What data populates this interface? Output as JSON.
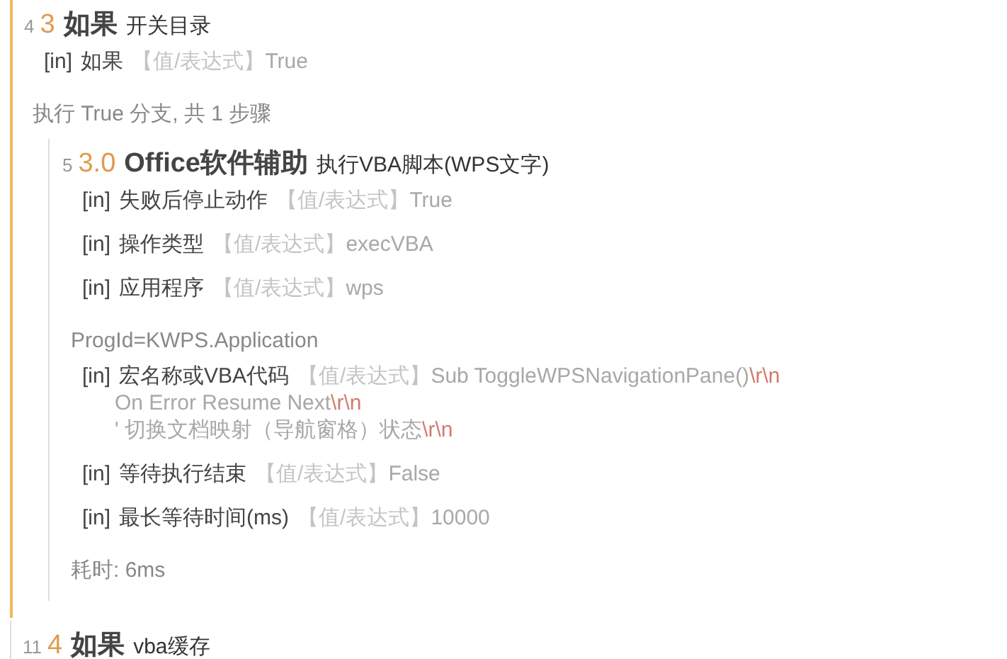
{
  "blocks": [
    {
      "line_no": "4",
      "index": "3",
      "title": "如果",
      "description": "开关目录",
      "highlighted": true,
      "items": [
        {
          "kind": "param",
          "tag": "[in]",
          "name": "如果",
          "type_hint": "【值/表达式】",
          "value": "True"
        },
        {
          "kind": "note",
          "text": "执行 True 分支, 共 1 步骤"
        },
        {
          "kind": "block",
          "line_no": "5",
          "index": "3.0",
          "title": "Office软件辅助",
          "description": "执行VBA脚本(WPS文字)",
          "highlighted": false,
          "items": [
            {
              "kind": "param",
              "tag": "[in]",
              "name": "失败后停止动作",
              "type_hint": "【值/表达式】",
              "value": "True"
            },
            {
              "kind": "param",
              "tag": "[in]",
              "name": "操作类型",
              "type_hint": "【值/表达式】",
              "value": "execVBA"
            },
            {
              "kind": "param",
              "tag": "[in]",
              "name": "应用程序",
              "type_hint": "【值/表达式】",
              "value": "wps"
            },
            {
              "kind": "note",
              "text": "ProgId=KWPS.Application"
            },
            {
              "kind": "param",
              "tag": "[in]",
              "name": "宏名称或VBA代码",
              "type_hint": "【值/表达式】",
              "value": "Sub ToggleWPSNavigationPane()",
              "value_eol": "\\r\\n",
              "more_lines": [
                {
                  "text": "On Error Resume Next",
                  "eol": "\\r\\n"
                },
                {
                  "text": "' 切换文档映射（导航窗格）状态",
                  "eol": "\\r\\n"
                }
              ]
            },
            {
              "kind": "param",
              "tag": "[in]",
              "name": "等待执行结束",
              "type_hint": "【值/表达式】",
              "value": "False"
            },
            {
              "kind": "param",
              "tag": "[in]",
              "name": "最长等待时间(ms)",
              "type_hint": "【值/表达式】",
              "value": "10000"
            },
            {
              "kind": "note",
              "text": "耗时:  6ms"
            }
          ]
        }
      ]
    },
    {
      "line_no": "11",
      "index": "4",
      "title": "如果",
      "description": "vba缓存",
      "highlighted": false
    }
  ]
}
